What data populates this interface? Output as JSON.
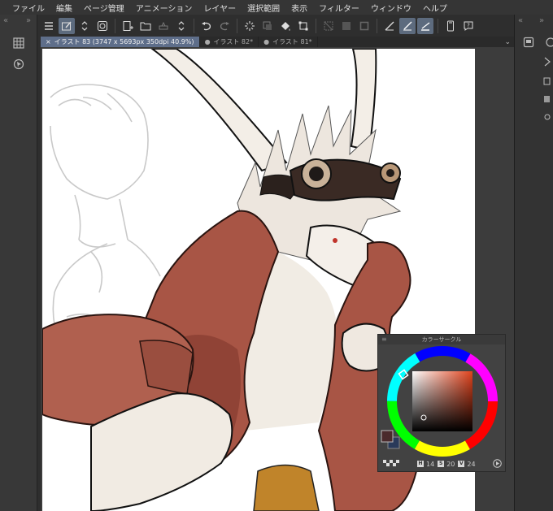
{
  "menu": [
    "ファイル",
    "編集",
    "ページ管理",
    "アニメーション",
    "レイヤー",
    "選択範囲",
    "表示",
    "フィルター",
    "ウィンドウ",
    "ヘルプ"
  ],
  "tabs": [
    {
      "close": "×",
      "label": "イラスト 83 (3747 x 5693px 350dpi 40.9%)",
      "active": true
    },
    {
      "dot": "●",
      "label": "イラスト 82*",
      "active": false
    },
    {
      "dot": "●",
      "label": "イラスト 81*",
      "active": false
    }
  ],
  "tabs_menu_icon": "⌄",
  "left_chevrons": {
    "left": "«",
    "right": "»"
  },
  "right_chevrons": {
    "left": "«",
    "right": "»"
  },
  "color_panel": {
    "title": "カラーサークル",
    "hue": "14",
    "saturation": "20",
    "value": "24",
    "h_key": "H",
    "s_key": "S",
    "v_key": "V",
    "main_color": "#4a2a2c",
    "sub_color": "#2a3a5a"
  },
  "colors": {
    "toolbar_active": "#5d6b7e",
    "tab_active": "#5e6e8a",
    "vest": "#a85545",
    "vest_dark": "#6f2e24",
    "fur": "#f2ece6",
    "goggles": "#3a2a24"
  }
}
